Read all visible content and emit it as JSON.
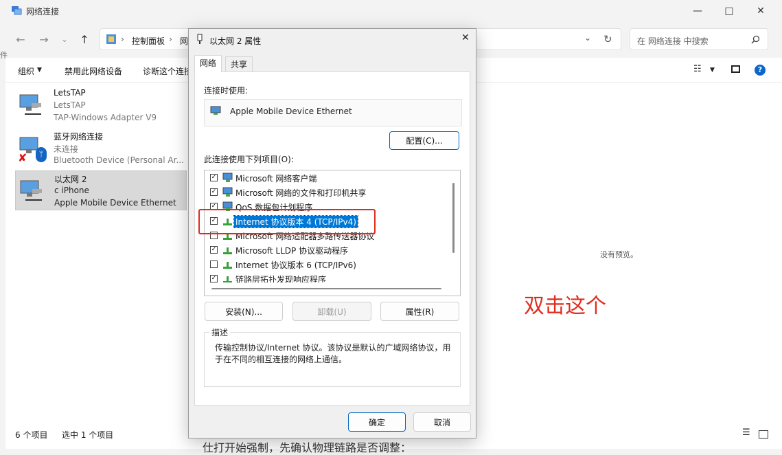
{
  "explorer": {
    "title": "网络连接",
    "address_crumbs": [
      "控制面板",
      "网"
    ],
    "search_placeholder": "在 网络连接 中搜索",
    "commands": [
      "组织",
      "禁用此网络设备",
      "诊断这个连接"
    ],
    "connections": [
      {
        "name": "LetsTAP",
        "status": "LetsTAP",
        "device": "TAP-Windows Adapter V9"
      },
      {
        "name": "蓝牙网络连接",
        "status": "未连接",
        "device": "Bluetooth Device (Personal Ar..."
      },
      {
        "name": "以太网 2",
        "status": "c iPhone",
        "device": "Apple Mobile Device Ethernet"
      }
    ],
    "no_preview": "没有预览。",
    "status_count": "6 个项目",
    "status_selected": "选中 1 个项目",
    "bg_text_bottom": "仕打开始强制，先确认物理链路是否调整：",
    "bg_text_left": "件"
  },
  "annotation": "双击这个",
  "dialog": {
    "title": "以太网 2 属性",
    "tabs": [
      "网络",
      "共享"
    ],
    "connect_using_label": "连接时使用:",
    "adapter": "Apple Mobile Device Ethernet",
    "configure_button": "配置(C)...",
    "components_label": "此连接使用下列项目(O):",
    "components": [
      {
        "label": "Microsoft 网络客户端",
        "checked": true
      },
      {
        "label": "Microsoft 网络的文件和打印机共享",
        "checked": true
      },
      {
        "label": "QoS 数据包计划程序",
        "checked": true
      },
      {
        "label": "Internet 协议版本 4 (TCP/IPv4)",
        "checked": true
      },
      {
        "label": "Microsoft 网络适配器多路传送器协议",
        "checked": false
      },
      {
        "label": "Microsoft LLDP 协议驱动程序",
        "checked": true
      },
      {
        "label": "Internet 协议版本 6 (TCP/IPv6)",
        "checked": false
      },
      {
        "label": "链路层拓扑发现响应程序",
        "checked": true
      }
    ],
    "install_button": "安装(N)...",
    "uninstall_button": "卸载(U)",
    "properties_button": "属性(R)",
    "description_title": "描述",
    "description": "传输控制协议/Internet 协议。该协议是默认的广域网络协议，用于在不同的相互连接的网络上通信。",
    "ok_button": "确定",
    "cancel_button": "取消"
  },
  "colors": {
    "accent": "#0078d7",
    "annotation_red": "#e12b1d",
    "selected_bg": "#d9d9d9"
  }
}
